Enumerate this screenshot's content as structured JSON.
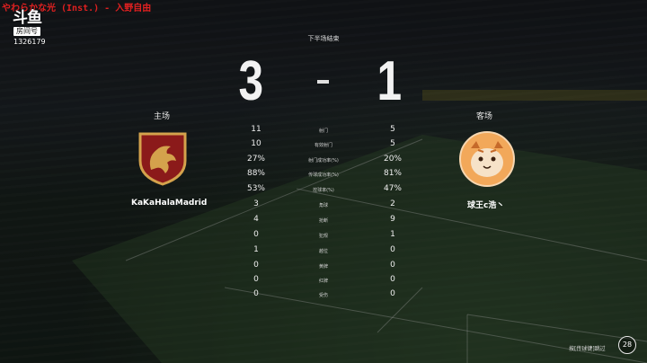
{
  "stream": {
    "song_title": "やわらかな光 (Inst.) - 入野自由",
    "platform_logo": "斗鱼",
    "room_label": "房间号",
    "room_number": "1326179"
  },
  "match": {
    "period_label": "下半场结束",
    "home": {
      "side_label": "主场",
      "team_name": "KaKaHalaMadrid",
      "score": "3",
      "crest_icon": "dragon-crest-icon"
    },
    "away": {
      "side_label": "客场",
      "team_name": "球王c浩丶",
      "score": "1",
      "crest_icon": "tiger-avatar-icon"
    },
    "score_separator": "–"
  },
  "stats": [
    {
      "label": "射门",
      "home": "11",
      "away": "5"
    },
    {
      "label": "有效射门",
      "home": "10",
      "away": "5"
    },
    {
      "label": "射门成功率(%)",
      "home": "27%",
      "away": "20%"
    },
    {
      "label": "传球成功率(%)",
      "home": "88%",
      "away": "81%"
    },
    {
      "label": "控球率(%)",
      "home": "53%",
      "away": "47%"
    },
    {
      "label": "角球",
      "home": "3",
      "away": "2"
    },
    {
      "label": "抢断",
      "home": "4",
      "away": "9"
    },
    {
      "label": "犯规",
      "home": "0",
      "away": "1"
    },
    {
      "label": "越位",
      "home": "1",
      "away": "0"
    },
    {
      "label": "黄牌",
      "home": "0",
      "away": "0"
    },
    {
      "label": "红牌",
      "home": "0",
      "away": "0"
    },
    {
      "label": "受伤",
      "home": "0",
      "away": "0"
    }
  ],
  "footer": {
    "skip_hint": "按[传球键]跳过",
    "countdown": "28"
  },
  "colors": {
    "song_title": "#e02020",
    "home_crest_bg": "#8b1a1a",
    "home_crest_gold": "#d4a24c",
    "away_avatar_bg": "#f2a85a"
  }
}
